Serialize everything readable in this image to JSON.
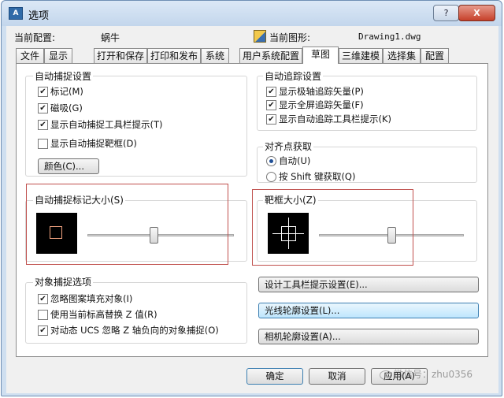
{
  "window": {
    "title": "选项",
    "app_icon": "autocad-icon",
    "help_label": "?",
    "close_label": "X"
  },
  "profile": {
    "config_label": "当前配置:",
    "config_value": "蜗牛",
    "drawing_label": "当前图形:",
    "drawing_value": "Drawing1.dwg"
  },
  "tabs": [
    {
      "label": "文件",
      "active": false
    },
    {
      "label": "显示",
      "active": false
    },
    {
      "label": "打开和保存",
      "active": false
    },
    {
      "label": "打印和发布",
      "active": false
    },
    {
      "label": "系统",
      "active": false
    },
    {
      "label": "用户系统配置",
      "active": false
    },
    {
      "label": "草图",
      "active": true
    },
    {
      "label": "三维建模",
      "active": false
    },
    {
      "label": "选择集",
      "active": false
    },
    {
      "label": "配置",
      "active": false
    }
  ],
  "autosnap": {
    "title": "自动捕捉设置",
    "options": [
      {
        "label": "标记(M)",
        "checked": true
      },
      {
        "label": "磁吸(G)",
        "checked": true
      },
      {
        "label": "显示自动捕捉工具栏提示(T)",
        "checked": true
      },
      {
        "label": "显示自动捕捉靶框(D)",
        "checked": false
      }
    ],
    "color_button": "颜色(C)..."
  },
  "autotrack": {
    "title": "自动追踪设置",
    "options": [
      {
        "label": "显示极轴追踪矢量(P)",
        "checked": true
      },
      {
        "label": "显示全屏追踪矢量(F)",
        "checked": true
      },
      {
        "label": "显示自动追踪工具栏提示(K)",
        "checked": true
      }
    ]
  },
  "alignment": {
    "title": "对齐点获取",
    "options": [
      {
        "label": "自动(U)",
        "selected": true
      },
      {
        "label": "按 Shift 键获取(Q)",
        "selected": false
      }
    ]
  },
  "marker_size": {
    "title": "自动捕捉标记大小(S)",
    "value": 0.45
  },
  "aperture_size": {
    "title": "靶框大小(Z)",
    "value": 0.5
  },
  "osnap": {
    "title": "对象捕捉选项",
    "options": [
      {
        "label": "忽略图案填充对象(I)",
        "checked": true
      },
      {
        "label": "使用当前标高替换 Z 值(R)",
        "checked": false
      },
      {
        "label": "对动态 UCS 忽略 Z 轴负向的对象捕捉(O)",
        "checked": true
      }
    ]
  },
  "side_buttons": {
    "tooltip_settings": "设计工具栏提示设置(E)...",
    "lightglyph_settings": "光线轮廓设置(L)...",
    "camera_settings": "相机轮廓设置(A)..."
  },
  "footer": {
    "ok": "确定",
    "cancel": "取消",
    "apply": "应用(A)"
  },
  "watermark": {
    "text": "微信号：zhu0356"
  },
  "colors": {
    "highlight_border": "#c0504d",
    "marker_square": "#f4a582",
    "aperture_cross": "#ffffff"
  }
}
